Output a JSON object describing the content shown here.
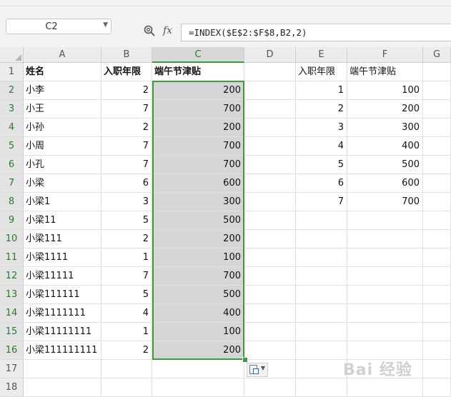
{
  "name_box": "C2",
  "formula_icon": "fx",
  "formula": "=INDEX($E$2:$F$8,B2,2)",
  "columns": [
    "A",
    "B",
    "C",
    "D",
    "E",
    "F",
    "G"
  ],
  "rows": [
    "1",
    "2",
    "3",
    "4",
    "5",
    "6",
    "7",
    "8",
    "9",
    "10",
    "11",
    "12",
    "13",
    "14",
    "15",
    "16",
    "17",
    "18"
  ],
  "headers": {
    "a": "姓名",
    "b": "入职年限",
    "c": "端午节津贴",
    "e": "入职年限",
    "f": "端午节津贴"
  },
  "names": [
    "小李",
    "小王",
    "小孙",
    "小周",
    "小孔",
    "小梁",
    "小梁1",
    "小梁11",
    "小梁111",
    "小梁1111",
    "小梁11111",
    "小梁111111",
    "小梁1111111",
    "小梁11111111",
    "小梁111111111"
  ],
  "years": [
    "2",
    "7",
    "2",
    "7",
    "7",
    "6",
    "3",
    "5",
    "2",
    "1",
    "7",
    "5",
    "4",
    "1",
    "2"
  ],
  "allowance": [
    "200",
    "700",
    "200",
    "700",
    "700",
    "600",
    "300",
    "500",
    "200",
    "100",
    "700",
    "500",
    "400",
    "100",
    "200"
  ],
  "lookup_years": [
    "1",
    "2",
    "3",
    "4",
    "5",
    "6",
    "7"
  ],
  "lookup_allowance": [
    "100",
    "200",
    "300",
    "400",
    "500",
    "600",
    "700"
  ],
  "watermark": "Bai 经验",
  "colors": {
    "selection_border": "#3d9a3d",
    "selected_fill": "#d6d6d6",
    "header_bg": "#ececec"
  }
}
